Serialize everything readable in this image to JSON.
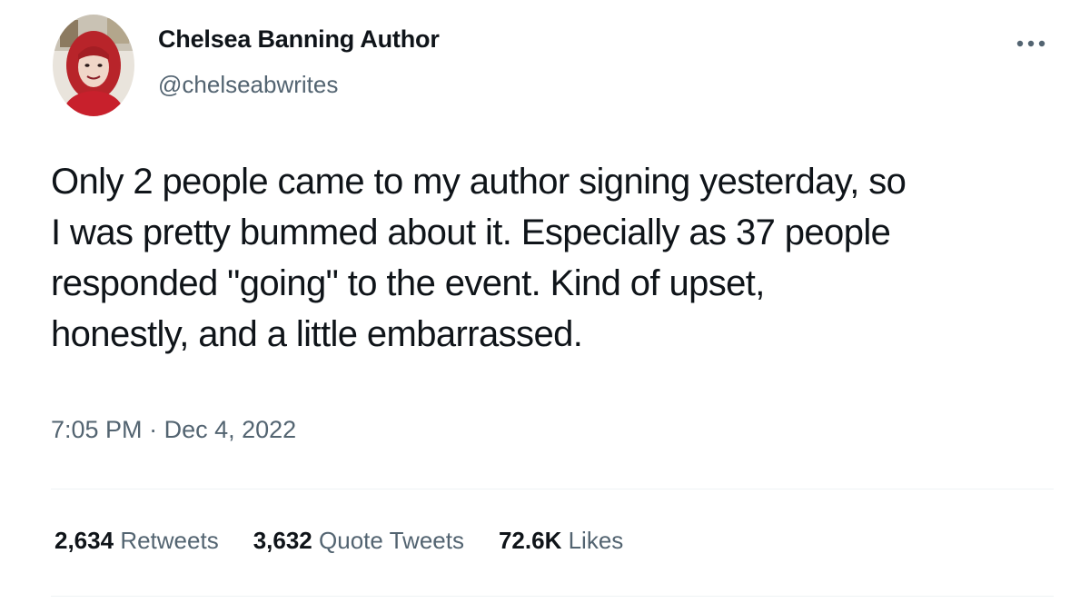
{
  "author": {
    "display_name": "Chelsea Banning Author",
    "handle": "@chelseabwrites"
  },
  "tweet": {
    "text": "Only 2 people came to my author signing yesterday, so\nI was pretty bummed about it. Especially as 37 people\nresponded \"going\" to the event. Kind of upset,\nhonestly, and a little embarrassed.",
    "time": "7:05 PM",
    "separator": "·",
    "date": "Dec 4, 2022"
  },
  "stats": {
    "retweets": {
      "count": "2,634",
      "label": "Retweets"
    },
    "quote_tweets": {
      "count": "3,632",
      "label": "Quote Tweets"
    },
    "likes": {
      "count": "72.6K",
      "label": "Likes"
    }
  },
  "icons": {
    "more": "more-options-icon",
    "avatar": "profile-avatar"
  },
  "colors": {
    "text_primary": "#0f1419",
    "text_secondary": "#536471",
    "divider": "#eff3f4",
    "background": "#ffffff"
  }
}
